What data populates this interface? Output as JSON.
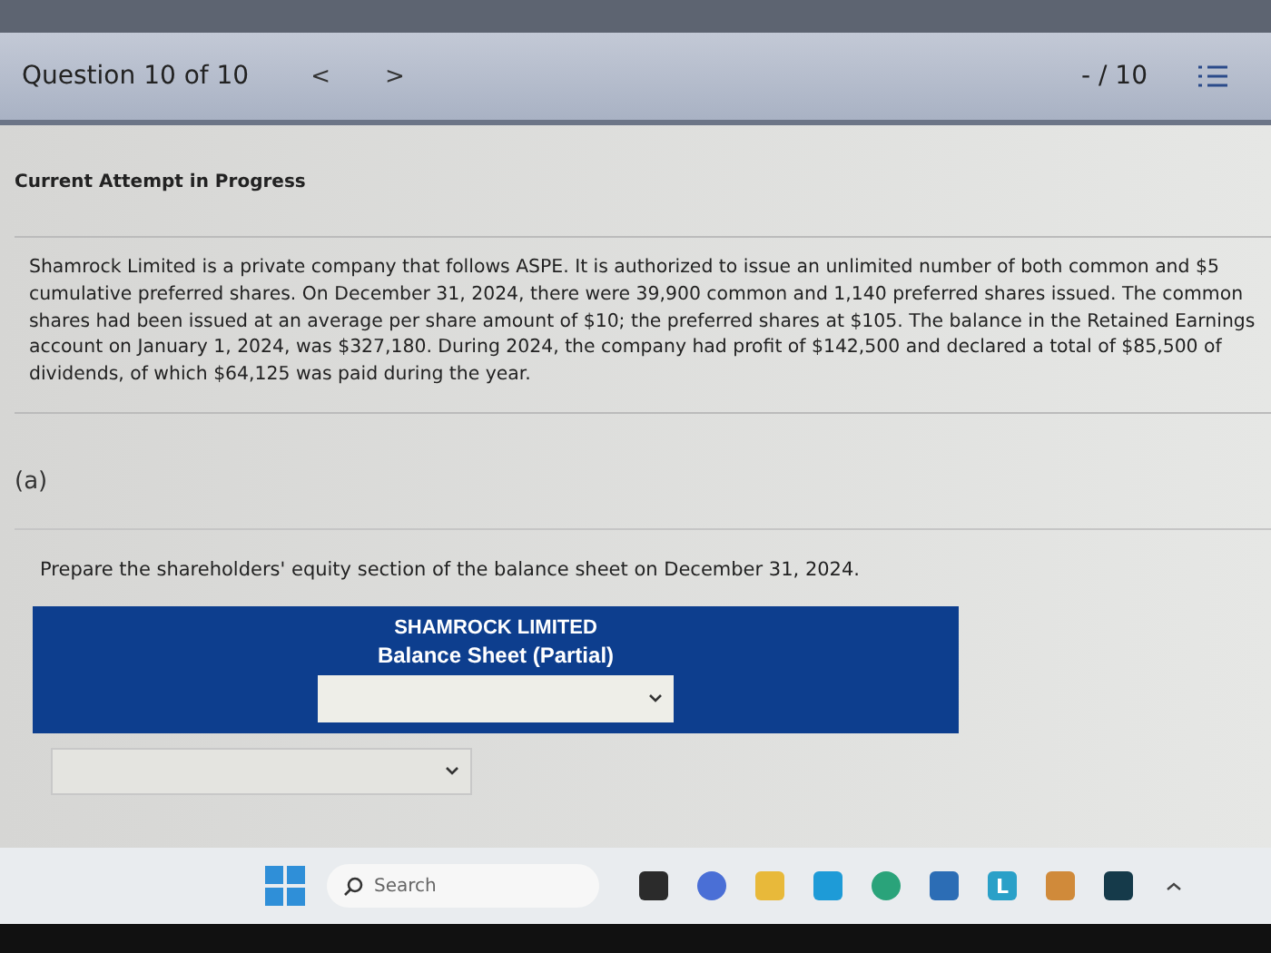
{
  "header": {
    "title": "Question 10 of 10",
    "prev": "<",
    "next": ">",
    "score": "- / 10"
  },
  "attempt_status": "Current Attempt in Progress",
  "problem_text": "Shamrock Limited is a private company that follows ASPE. It is authorized to issue an unlimited number of both common and $5 cumulative preferred shares. On December 31, 2024, there were 39,900 common and 1,140 preferred shares issued. The common shares had been issued at an average per share amount of $10; the preferred shares at $105. The balance in the Retained Earnings account on January 1, 2024, was $327,180. During 2024, the company had profit of $142,500 and declared a total of $85,500 of dividends, of which $64,125 was paid during the year.",
  "part": {
    "label": "(a)",
    "instruction": "Prepare the shareholders' equity section of the balance sheet on December 31, 2024.",
    "statement": {
      "company": "SHAMROCK LIMITED",
      "title": "Balance Sheet (Partial)"
    }
  },
  "taskbar": {
    "search_placeholder": "Search",
    "apps": [
      {
        "kind": "widgets"
      },
      {
        "kind": "meet"
      },
      {
        "kind": "folder"
      },
      {
        "kind": "square"
      },
      {
        "kind": "edge"
      },
      {
        "kind": "store"
      },
      {
        "kind": "letter",
        "label": "L"
      },
      {
        "kind": "game"
      },
      {
        "kind": "dark"
      }
    ]
  }
}
